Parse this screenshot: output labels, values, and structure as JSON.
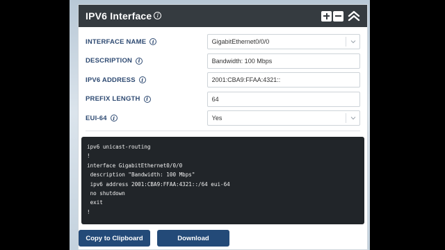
{
  "header": {
    "title": "IPV6 Interface",
    "info_icon": "i"
  },
  "form": {
    "fields": [
      {
        "label": "INTERFACE NAME",
        "value": "GigabitEthernet0/0/0",
        "type": "select"
      },
      {
        "label": "DESCRIPTION",
        "value": "Bandwidth: 100 Mbps",
        "type": "text"
      },
      {
        "label": "IPV6 ADDRESS",
        "value": "2001:CBA9:FFAA:4321::",
        "type": "text"
      },
      {
        "label": "PREFIX LENGTH",
        "value": "64",
        "type": "text"
      },
      {
        "label": "EUI-64",
        "value": "Yes",
        "type": "select"
      }
    ]
  },
  "code": {
    "lines": [
      "ipv6 unicast-routing",
      "!",
      "interface GigabitEthernet0/0/0",
      " description \"Bandwidth: 100 Mbps\"",
      " ipv6 address 2001:CBA9:FFAA:4321::/64 eui-64",
      " no shutdown",
      " exit",
      "!"
    ]
  },
  "buttons": {
    "copy": "Copy to Clipboard",
    "download": "Download"
  },
  "colors": {
    "header_bg": "#353b40",
    "label_color": "#2e4a72",
    "button_bg": "#234a78",
    "code_bg": "#212529"
  },
  "icons": {
    "add": "plus-square-icon",
    "remove": "minus-square-icon",
    "collapse": "double-chevron-up-icon",
    "info": "info-circle-icon"
  }
}
